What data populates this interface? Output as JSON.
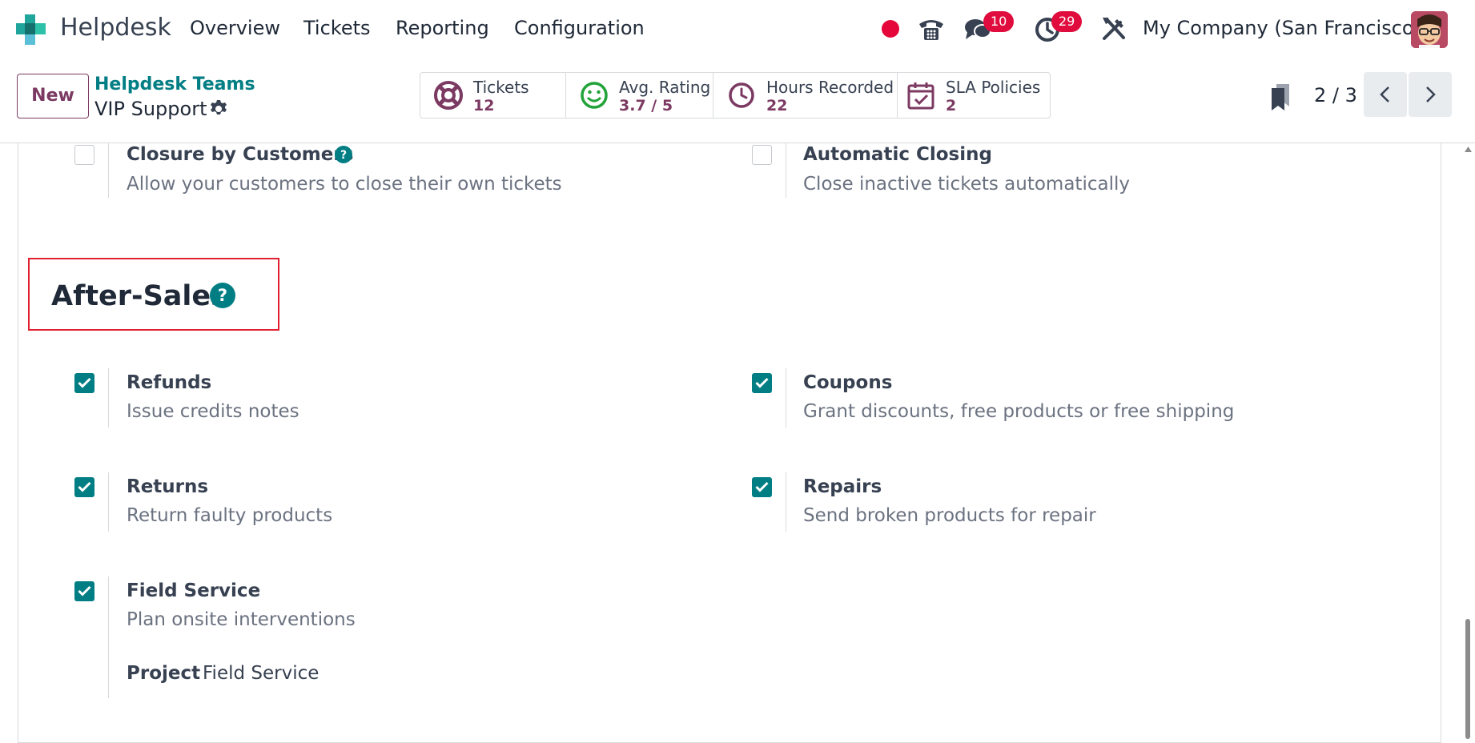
{
  "navbar": {
    "app_name": "Helpdesk",
    "menu": [
      "Overview",
      "Tickets",
      "Reporting",
      "Configuration"
    ],
    "messages_badge": "10",
    "activities_badge": "29",
    "company": "My Company (San Francisco)",
    "icons": [
      "recording-dot-icon",
      "phone-icon",
      "chat-icon",
      "clock-icon",
      "tools-icon",
      "avatar"
    ],
    "accent_color": "#7c3a62",
    "badge_color": "#e00c3d"
  },
  "control": {
    "new_label": "New",
    "breadcrumb_parent": "Helpdesk Teams",
    "breadcrumb_current": "VIP Support",
    "stats": [
      {
        "label": "Tickets",
        "value": "12",
        "icon": "lifebuoy-icon"
      },
      {
        "label": "Avg. Rating",
        "value": "3.7 / 5",
        "icon": "smiley-icon"
      },
      {
        "label": "Hours Recorded",
        "value": "22",
        "icon": "clock-icon"
      },
      {
        "label": "SLA Policies",
        "value": "2",
        "icon": "calendar-check-icon"
      }
    ],
    "pager": "2 / 3"
  },
  "form": {
    "top_settings": [
      {
        "title": "Closure by Customers",
        "desc": "Allow your customers to close their own tickets",
        "checked": false
      },
      {
        "title": "Automatic Closing",
        "desc": "Close inactive tickets automatically",
        "checked": false
      }
    ],
    "section_title": "After-Sales",
    "settings": [
      {
        "title": "Refunds",
        "desc": "Issue credits notes",
        "checked": true
      },
      {
        "title": "Coupons",
        "desc": "Grant discounts, free products or free shipping",
        "checked": true
      },
      {
        "title": "Returns",
        "desc": "Return faulty products",
        "checked": true
      },
      {
        "title": "Repairs",
        "desc": "Send broken products for repair",
        "checked": true
      },
      {
        "title": "Field Service",
        "desc": "Plan onsite interventions",
        "checked": true
      }
    ],
    "project_label": "Project",
    "project_value": "Field Service",
    "checkbox_color": "#017e84",
    "highlight_color": "#e0202e"
  }
}
